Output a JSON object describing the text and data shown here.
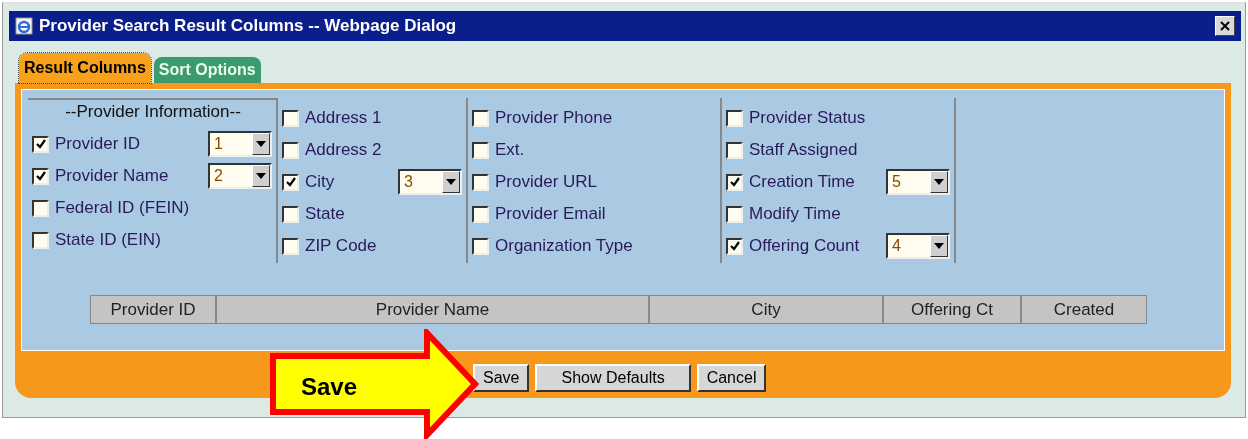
{
  "window": {
    "title": "Provider Search Result Columns -- Webpage Dialog"
  },
  "tabs": [
    {
      "label": "Result Columns",
      "selected": true
    },
    {
      "label": "Sort Options",
      "selected": false
    }
  ],
  "column_groups": [
    {
      "heading": "--Provider Information--",
      "items": [
        {
          "label": "Provider ID",
          "checked": true,
          "order": "1"
        },
        {
          "label": "Provider Name",
          "checked": true,
          "order": "2"
        },
        {
          "label": "Federal ID (FEIN)",
          "checked": false
        },
        {
          "label": "State ID (EIN)",
          "checked": false
        }
      ]
    },
    {
      "items": [
        {
          "label": "Address 1",
          "checked": false
        },
        {
          "label": "Address 2",
          "checked": false
        },
        {
          "label": "City",
          "checked": true,
          "order": "3"
        },
        {
          "label": "State",
          "checked": false
        },
        {
          "label": "ZIP Code",
          "checked": false
        }
      ]
    },
    {
      "items": [
        {
          "label": "Provider Phone",
          "checked": false
        },
        {
          "label": "Ext.",
          "checked": false
        },
        {
          "label": "Provider URL",
          "checked": false
        },
        {
          "label": "Provider Email",
          "checked": false
        },
        {
          "label": "Organization Type",
          "checked": false
        }
      ]
    },
    {
      "items": [
        {
          "label": "Provider Status",
          "checked": false
        },
        {
          "label": "Staff Assigned",
          "checked": false
        },
        {
          "label": "Creation Time",
          "checked": true,
          "order": "5"
        },
        {
          "label": "Modify Time",
          "checked": false
        },
        {
          "label": "Offering Count",
          "checked": true,
          "order": "4"
        }
      ]
    }
  ],
  "preview_columns": [
    "Provider ID",
    "Provider Name",
    "City",
    "Offering Ct",
    "Created"
  ],
  "buttons": [
    "Save",
    "Show Defaults",
    "Cancel"
  ],
  "callout": {
    "label": "Save"
  }
}
